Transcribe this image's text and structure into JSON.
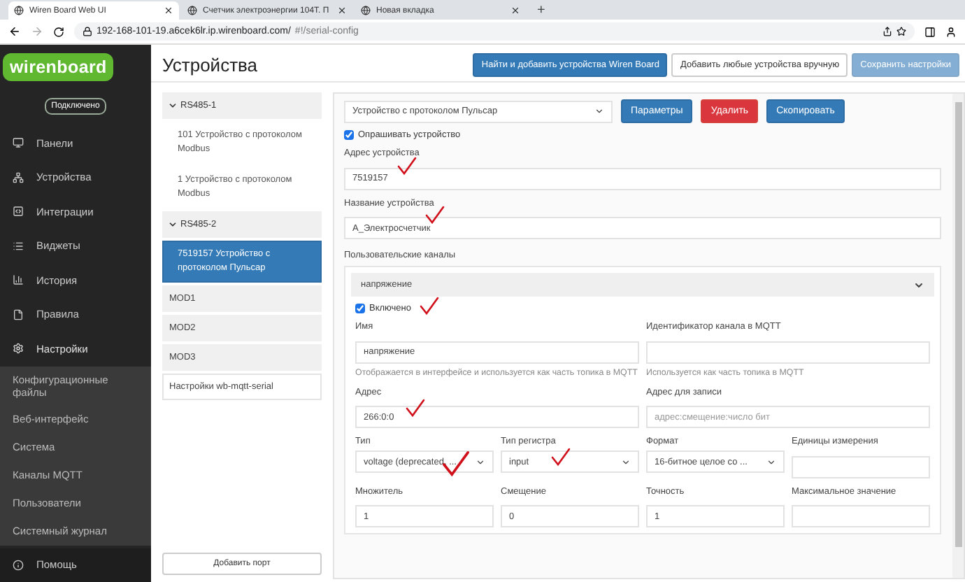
{
  "browser": {
    "tabs": [
      {
        "title": "Wiren Board Web UI",
        "selected": true
      },
      {
        "title": "Счетчик электроэнергии 104Т. П",
        "selected": false
      },
      {
        "title": "Новая вкладка",
        "selected": false
      }
    ],
    "new_tab": "+",
    "url_host": "192-168-101-19.a6cek6lr.ip.wirenboard.com/",
    "url_path": "#!/serial-config"
  },
  "sidebar": {
    "logo": "wirenboard",
    "status": "Подключено",
    "items": [
      {
        "label": "Панели"
      },
      {
        "label": "Устройства"
      },
      {
        "label": "Интеграции"
      },
      {
        "label": "Виджеты"
      },
      {
        "label": "История"
      },
      {
        "label": "Правила"
      },
      {
        "label": "Настройки",
        "expanded": true,
        "children": [
          {
            "label": "Конфигурационные файлы"
          },
          {
            "label": "Веб-интерфейс"
          },
          {
            "label": "Система"
          },
          {
            "label": "Каналы MQTT"
          },
          {
            "label": "Пользователи"
          },
          {
            "label": "Системный журнал"
          }
        ]
      }
    ],
    "help": "Помощь"
  },
  "page": {
    "title": "Устройства",
    "buttons": [
      {
        "label": "Найти и добавить устройства Wiren Board",
        "kind": "primary",
        "disabled": false
      },
      {
        "label": "Добавить любые устройства вручную",
        "kind": "default",
        "disabled": false
      },
      {
        "label": "Сохранить настройки",
        "kind": "primary",
        "disabled": true
      }
    ]
  },
  "ports": [
    {
      "kind": "port",
      "name": "RS485-1",
      "expanded": true,
      "devices": [
        {
          "label": "101 Устройство с протоколом Modbus",
          "selected": false
        },
        {
          "label": "1 Устройство с протоколом Modbus",
          "selected": false
        }
      ]
    },
    {
      "kind": "port",
      "name": "RS485-2",
      "expanded": true,
      "devices": [
        {
          "label": "7519157 Устройство с протоколом Пульсар",
          "selected": true
        }
      ]
    },
    {
      "kind": "module",
      "name": "MOD1"
    },
    {
      "kind": "module",
      "name": "MOD2"
    },
    {
      "kind": "module",
      "name": "MOD3"
    },
    {
      "kind": "settings",
      "name": "Настройки wb-mqtt-serial"
    }
  ],
  "add_port": "Добавить порт",
  "editor": {
    "device_type": "Устройство с протоколом Пульсар",
    "actions": [
      {
        "label": "Параметры",
        "kind": "primary"
      },
      {
        "label": "Удалить",
        "kind": "danger"
      },
      {
        "label": "Скопировать",
        "kind": "primary"
      }
    ],
    "poll": {
      "label": "Опрашивать устройство",
      "checked": true
    },
    "fields": [
      {
        "label": "Адрес устройства",
        "value": "7519157",
        "marked": true
      },
      {
        "label": "Название устройства",
        "value": "А_Электросчетчик",
        "marked": true
      }
    ],
    "channels_title": "Пользовательские каналы",
    "channel": {
      "title": "напряжение",
      "expanded": true,
      "enabled": {
        "label": "Включено",
        "checked": true,
        "marked": true
      },
      "rows": [
        [
          {
            "kind": "input",
            "label": "Имя",
            "value": "напряжение",
            "hint": "Отображается в интерфейсе и используется как часть топика в MQTT"
          },
          {
            "kind": "input",
            "label": "Идентификатор канала в MQTT",
            "hint": "Используется как часть топика в MQTT"
          }
        ],
        [
          {
            "kind": "input",
            "label": "Адрес",
            "value": "266:0:0",
            "marked": true
          },
          {
            "kind": "input",
            "label": "Адрес для записи",
            "placeholder": "адрес:смещение:число бит"
          }
        ],
        [
          {
            "kind": "select",
            "label": "Тип",
            "value": "voltage (deprecated, ...",
            "marked": true
          },
          {
            "kind": "select",
            "label": "Тип регистра",
            "value": "input",
            "marked": true
          },
          {
            "kind": "select",
            "label": "Формат",
            "value": "16-битное целое со ..."
          },
          {
            "kind": "input",
            "label": "Единицы измерения"
          }
        ],
        [
          {
            "kind": "input",
            "label": "Множитель",
            "value": "1"
          },
          {
            "kind": "input",
            "label": "Смещение",
            "value": "0"
          },
          {
            "kind": "input",
            "label": "Точность",
            "value": "1"
          },
          {
            "kind": "input",
            "label": "Максимальное значение"
          }
        ]
      ]
    }
  }
}
